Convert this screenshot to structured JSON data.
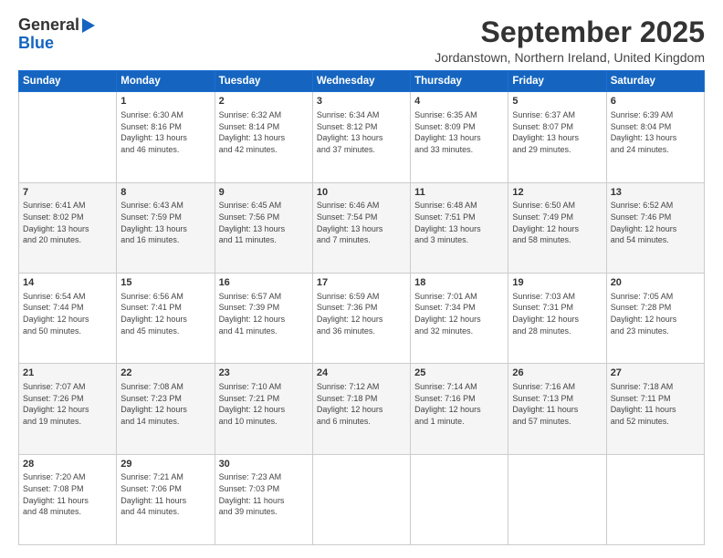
{
  "header": {
    "logo_general": "General",
    "logo_blue": "Blue",
    "month_title": "September 2025",
    "location": "Jordanstown, Northern Ireland, United Kingdom"
  },
  "columns": [
    "Sunday",
    "Monday",
    "Tuesday",
    "Wednesday",
    "Thursday",
    "Friday",
    "Saturday"
  ],
  "weeks": [
    [
      {
        "day": "",
        "info": ""
      },
      {
        "day": "1",
        "info": "Sunrise: 6:30 AM\nSunset: 8:16 PM\nDaylight: 13 hours\nand 46 minutes."
      },
      {
        "day": "2",
        "info": "Sunrise: 6:32 AM\nSunset: 8:14 PM\nDaylight: 13 hours\nand 42 minutes."
      },
      {
        "day": "3",
        "info": "Sunrise: 6:34 AM\nSunset: 8:12 PM\nDaylight: 13 hours\nand 37 minutes."
      },
      {
        "day": "4",
        "info": "Sunrise: 6:35 AM\nSunset: 8:09 PM\nDaylight: 13 hours\nand 33 minutes."
      },
      {
        "day": "5",
        "info": "Sunrise: 6:37 AM\nSunset: 8:07 PM\nDaylight: 13 hours\nand 29 minutes."
      },
      {
        "day": "6",
        "info": "Sunrise: 6:39 AM\nSunset: 8:04 PM\nDaylight: 13 hours\nand 24 minutes."
      }
    ],
    [
      {
        "day": "7",
        "info": "Sunrise: 6:41 AM\nSunset: 8:02 PM\nDaylight: 13 hours\nand 20 minutes."
      },
      {
        "day": "8",
        "info": "Sunrise: 6:43 AM\nSunset: 7:59 PM\nDaylight: 13 hours\nand 16 minutes."
      },
      {
        "day": "9",
        "info": "Sunrise: 6:45 AM\nSunset: 7:56 PM\nDaylight: 13 hours\nand 11 minutes."
      },
      {
        "day": "10",
        "info": "Sunrise: 6:46 AM\nSunset: 7:54 PM\nDaylight: 13 hours\nand 7 minutes."
      },
      {
        "day": "11",
        "info": "Sunrise: 6:48 AM\nSunset: 7:51 PM\nDaylight: 13 hours\nand 3 minutes."
      },
      {
        "day": "12",
        "info": "Sunrise: 6:50 AM\nSunset: 7:49 PM\nDaylight: 12 hours\nand 58 minutes."
      },
      {
        "day": "13",
        "info": "Sunrise: 6:52 AM\nSunset: 7:46 PM\nDaylight: 12 hours\nand 54 minutes."
      }
    ],
    [
      {
        "day": "14",
        "info": "Sunrise: 6:54 AM\nSunset: 7:44 PM\nDaylight: 12 hours\nand 50 minutes."
      },
      {
        "day": "15",
        "info": "Sunrise: 6:56 AM\nSunset: 7:41 PM\nDaylight: 12 hours\nand 45 minutes."
      },
      {
        "day": "16",
        "info": "Sunrise: 6:57 AM\nSunset: 7:39 PM\nDaylight: 12 hours\nand 41 minutes."
      },
      {
        "day": "17",
        "info": "Sunrise: 6:59 AM\nSunset: 7:36 PM\nDaylight: 12 hours\nand 36 minutes."
      },
      {
        "day": "18",
        "info": "Sunrise: 7:01 AM\nSunset: 7:34 PM\nDaylight: 12 hours\nand 32 minutes."
      },
      {
        "day": "19",
        "info": "Sunrise: 7:03 AM\nSunset: 7:31 PM\nDaylight: 12 hours\nand 28 minutes."
      },
      {
        "day": "20",
        "info": "Sunrise: 7:05 AM\nSunset: 7:28 PM\nDaylight: 12 hours\nand 23 minutes."
      }
    ],
    [
      {
        "day": "21",
        "info": "Sunrise: 7:07 AM\nSunset: 7:26 PM\nDaylight: 12 hours\nand 19 minutes."
      },
      {
        "day": "22",
        "info": "Sunrise: 7:08 AM\nSunset: 7:23 PM\nDaylight: 12 hours\nand 14 minutes."
      },
      {
        "day": "23",
        "info": "Sunrise: 7:10 AM\nSunset: 7:21 PM\nDaylight: 12 hours\nand 10 minutes."
      },
      {
        "day": "24",
        "info": "Sunrise: 7:12 AM\nSunset: 7:18 PM\nDaylight: 12 hours\nand 6 minutes."
      },
      {
        "day": "25",
        "info": "Sunrise: 7:14 AM\nSunset: 7:16 PM\nDaylight: 12 hours\nand 1 minute."
      },
      {
        "day": "26",
        "info": "Sunrise: 7:16 AM\nSunset: 7:13 PM\nDaylight: 11 hours\nand 57 minutes."
      },
      {
        "day": "27",
        "info": "Sunrise: 7:18 AM\nSunset: 7:11 PM\nDaylight: 11 hours\nand 52 minutes."
      }
    ],
    [
      {
        "day": "28",
        "info": "Sunrise: 7:20 AM\nSunset: 7:08 PM\nDaylight: 11 hours\nand 48 minutes."
      },
      {
        "day": "29",
        "info": "Sunrise: 7:21 AM\nSunset: 7:06 PM\nDaylight: 11 hours\nand 44 minutes."
      },
      {
        "day": "30",
        "info": "Sunrise: 7:23 AM\nSunset: 7:03 PM\nDaylight: 11 hours\nand 39 minutes."
      },
      {
        "day": "",
        "info": ""
      },
      {
        "day": "",
        "info": ""
      },
      {
        "day": "",
        "info": ""
      },
      {
        "day": "",
        "info": ""
      }
    ]
  ]
}
